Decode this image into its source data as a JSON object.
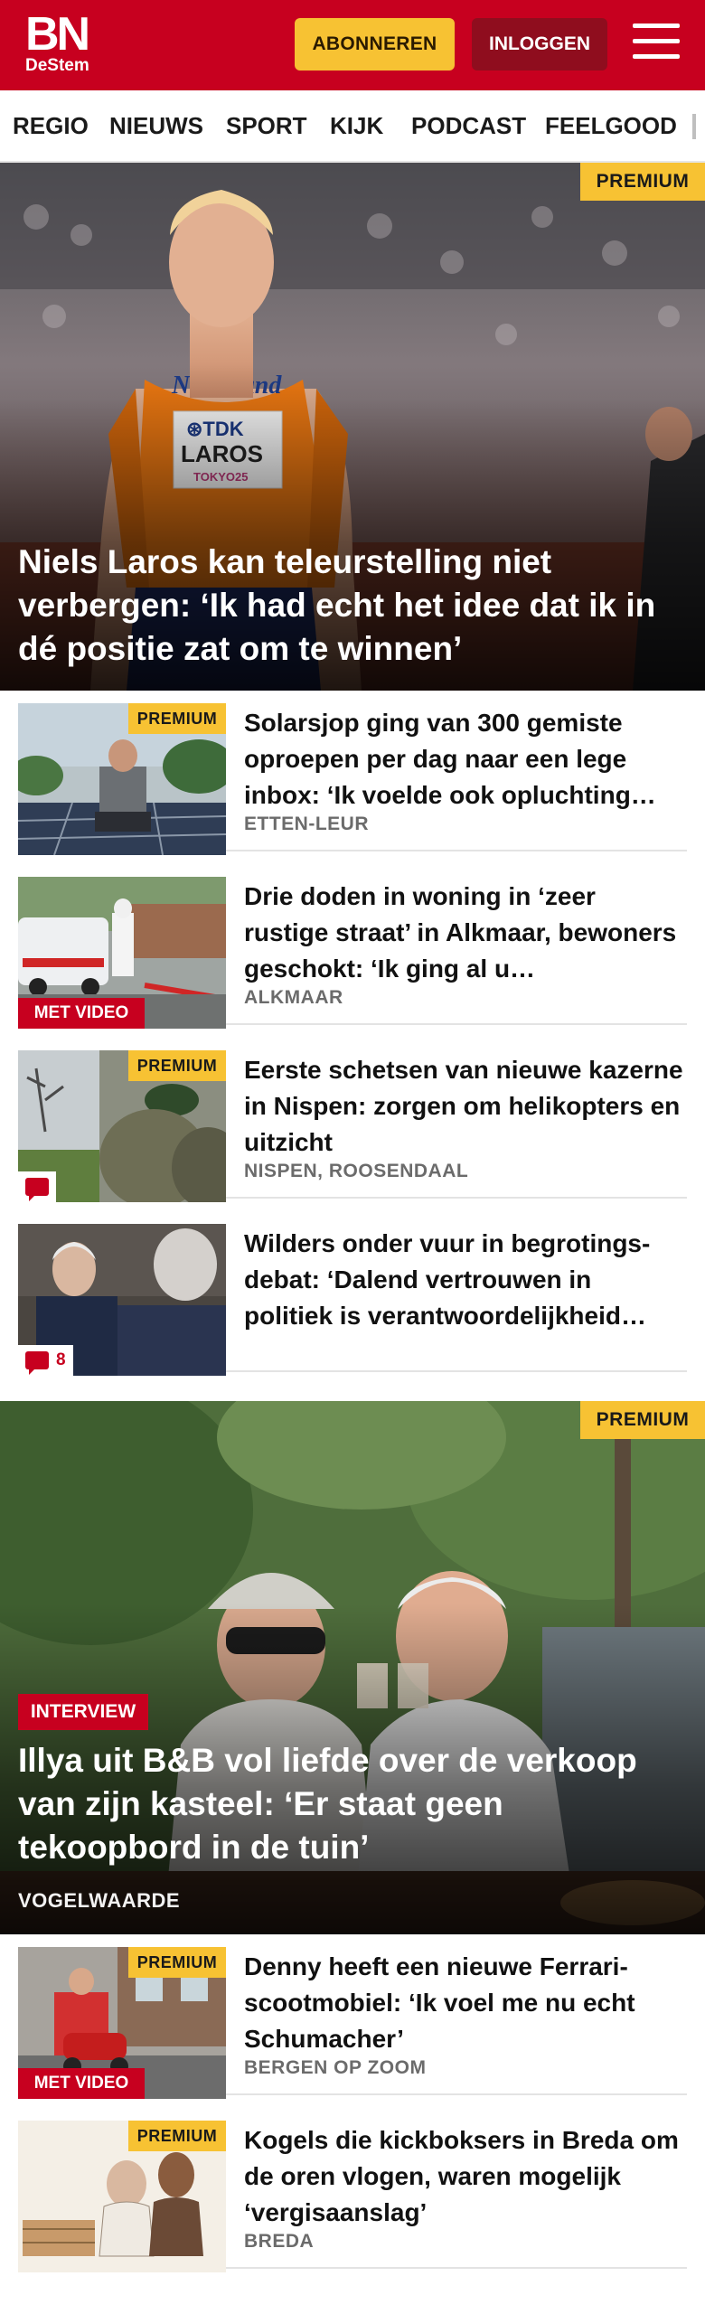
{
  "header": {
    "logo_main": "BN",
    "logo_sub": "DeStem",
    "subscribe_label": "ABONNEREN",
    "login_label": "INLOGGEN",
    "menu_icon": "hamburger-menu-icon"
  },
  "nav": {
    "items": [
      "REGIO",
      "NIEUWS",
      "SPORT",
      "KIJK",
      "PODCAST",
      "FEELGOOD"
    ]
  },
  "hero1": {
    "badge": "PREMIUM",
    "title": "Niels Laros kan teleurstelling niet verbergen: ‘Ik had echt het idee dat ik in dé positie zat om te winnen’",
    "bib_sponsor": "TDK",
    "bib_name": "LAROS",
    "bib_event": "TOKYO25",
    "shirt_text": "Nederland"
  },
  "articles": [
    {
      "title": "Solarsjop ging van 300 gemiste oproepen per dag naar een lege inbox: ‘Ik voelde ook opluchting…",
      "location": "ETTEN-LEUR",
      "badge": "PREMIUM"
    },
    {
      "title": "Drie doden in woning in ‘zeer rustige straat’ in Alkmaar, bewoners geschokt: ‘Ik ging al u…",
      "location": "ALKMAAR",
      "tag": "MET VIDEO"
    },
    {
      "title": "Eerste schetsen van nieuwe kazerne in Nispen: zorgen om helikopters en uitzicht",
      "location": "NISPEN, ROOSENDAAL",
      "badge": "PREMIUM",
      "comments_icon": "comment-icon"
    },
    {
      "title": "Wilders onder vuur in begrotings-debat: ‘Dalend vertrouwen in politiek is verantwoordelijkheid…",
      "comments": "8",
      "comments_icon": "comment-icon"
    }
  ],
  "hero2": {
    "badge": "PREMIUM",
    "tag": "INTERVIEW",
    "title": "Illya uit B&B vol liefde over de verkoop van zijn kasteel: ‘Er staat geen tekoopbord in de tuin’",
    "location": "VOGELWAARDE"
  },
  "articles2": [
    {
      "title": "Denny heeft een nieuwe Ferrari-scootmobiel: ‘Ik voel me nu echt Schumacher’",
      "location": "BERGEN OP ZOOM",
      "badge": "PREMIUM",
      "tag": "MET VIDEO"
    },
    {
      "title": "Kogels die kickboksers in Breda om de oren vlogen, waren mogelijk ‘vergisaanslag’",
      "location": "BREDA",
      "badge": "PREMIUM"
    }
  ],
  "colors": {
    "brand_red": "#c7001f",
    "premium_yellow": "#f7c233",
    "login_dark_red": "#8f0d1e"
  }
}
